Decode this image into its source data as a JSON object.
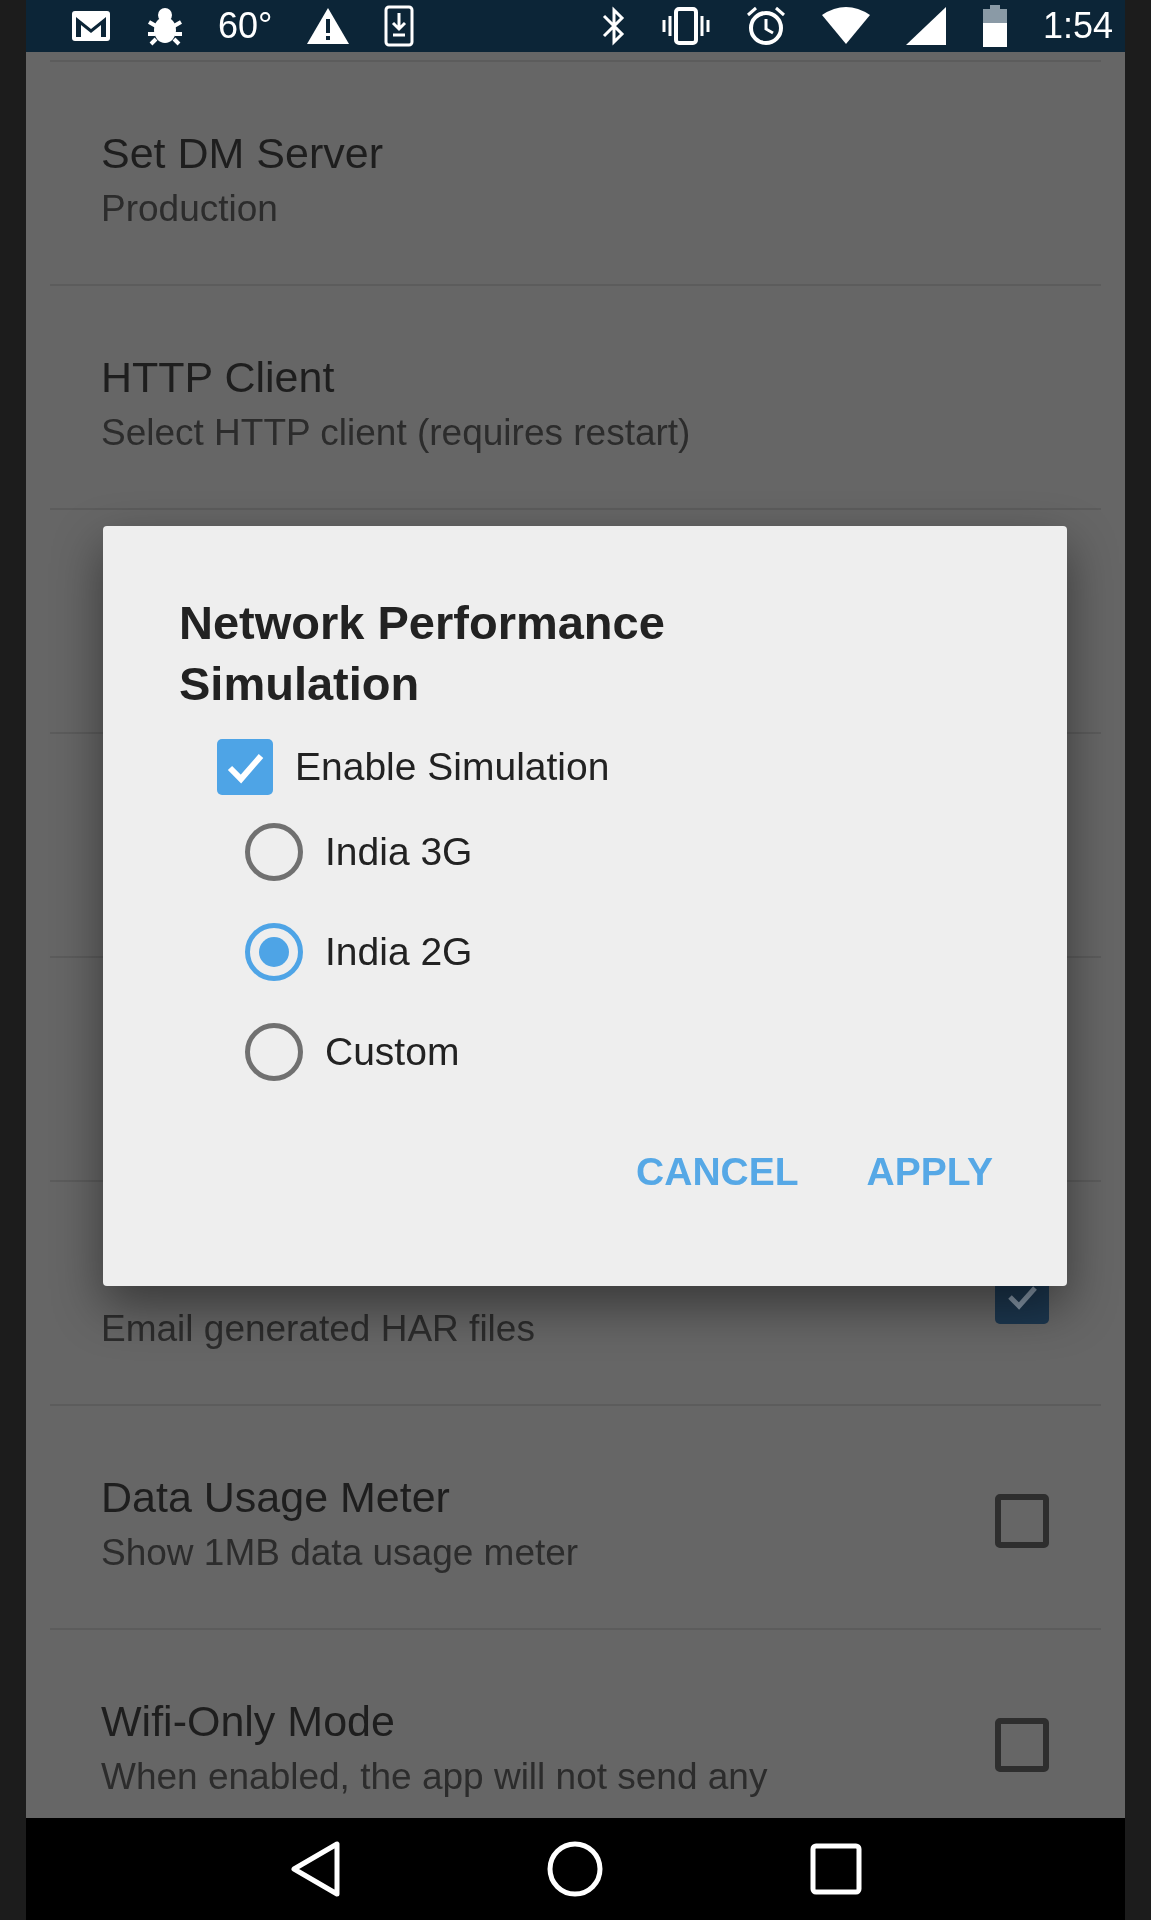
{
  "status_bar": {
    "temperature": "60°",
    "time": "1:54"
  },
  "settings": [
    {
      "kind": "plain",
      "title": "Set DM Server",
      "subtitle": "Production"
    },
    {
      "kind": "plain",
      "title": "HTTP Client",
      "subtitle": "Select HTTP client (requires restart)"
    },
    {
      "kind": "hidden"
    },
    {
      "kind": "hidden"
    },
    {
      "kind": "hidden"
    },
    {
      "kind": "checkbox",
      "subtitle": "Email generated HAR files",
      "checked": true
    },
    {
      "kind": "checkbox",
      "title": "Data Usage Meter",
      "subtitle": "Show 1MB data usage meter",
      "checked": false
    },
    {
      "kind": "checkbox",
      "title": "Wifi-Only Mode",
      "subtitle": "When enabled, the app will not send any",
      "checked": false
    }
  ],
  "dialog": {
    "title": "Network Performance Simulation",
    "checkbox": {
      "label": "Enable Simulation",
      "checked": true
    },
    "options": [
      {
        "label": "India 3G",
        "selected": false
      },
      {
        "label": "India 2G",
        "selected": true
      },
      {
        "label": "Custom",
        "selected": false
      }
    ],
    "buttons": [
      "CANCEL",
      "APPLY"
    ]
  }
}
